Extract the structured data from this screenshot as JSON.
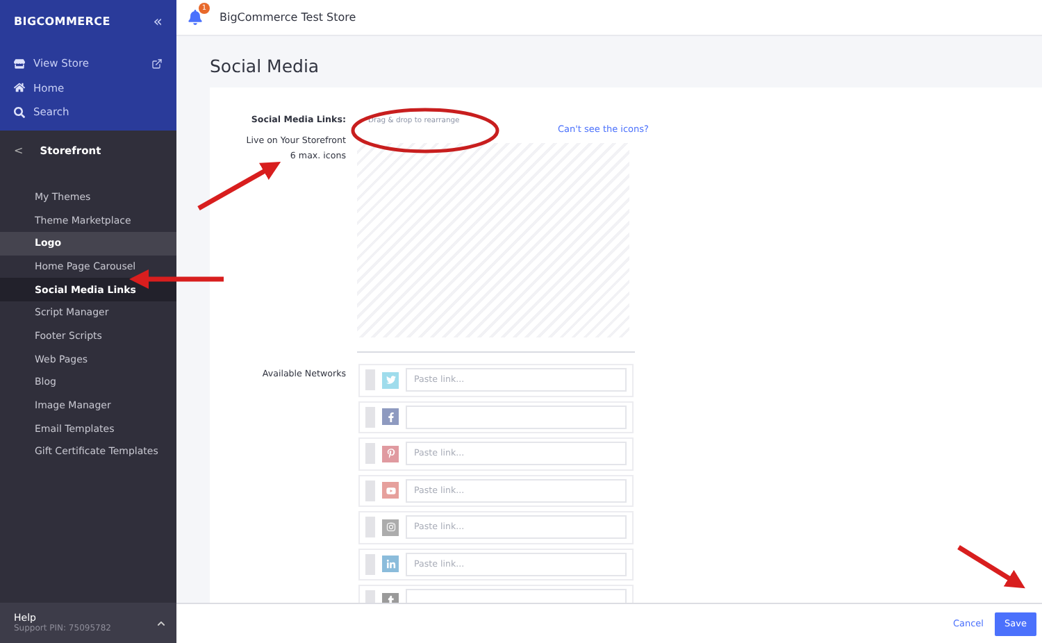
{
  "sidebar": {
    "logo": "BIGCOMMERCE",
    "collapse": "«",
    "nav": [
      {
        "label": "View Store",
        "kind": "store"
      },
      {
        "label": "Home",
        "kind": "home"
      },
      {
        "label": "Search",
        "kind": "search"
      }
    ],
    "section": {
      "back": "<",
      "title": "Storefront"
    },
    "items": [
      {
        "label": "My Themes",
        "selected": false,
        "hovered": false
      },
      {
        "label": "Theme Marketplace",
        "selected": false,
        "hovered": false
      },
      {
        "label": "Logo",
        "selected": false,
        "hovered": true
      },
      {
        "label": "Home Page Carousel",
        "selected": false,
        "hovered": false
      },
      {
        "label": "Social Media Links",
        "selected": true,
        "hovered": false
      },
      {
        "label": "Script Manager",
        "selected": false,
        "hovered": false
      },
      {
        "label": "Footer Scripts",
        "selected": false,
        "hovered": false
      },
      {
        "label": "Web Pages",
        "selected": false,
        "hovered": false
      },
      {
        "label": "Blog",
        "selected": false,
        "hovered": false
      },
      {
        "label": "Image Manager",
        "selected": false,
        "hovered": false
      },
      {
        "label": "Email Templates",
        "selected": false,
        "hovered": false
      },
      {
        "label": "Gift Certificate Templates",
        "selected": false,
        "hovered": false
      }
    ],
    "help": {
      "title": "Help",
      "pin": "Support PIN: 75095782"
    }
  },
  "header": {
    "badge": "1",
    "store": "BigCommerce Test Store"
  },
  "page": {
    "title": "Social Media",
    "links_label": "Social Media Links:",
    "live_label": "Live on Your Storefront",
    "max_label": "6 max. icons",
    "drop_hint": "Drag & drop to rearrange",
    "help_link": "Can't see the icons?",
    "networks_label": "Available Networks",
    "networks": [
      {
        "kind": "twitter",
        "color": "#9fdcec",
        "placeholder": "Paste link..."
      },
      {
        "kind": "facebook",
        "color": "#8e9ac0"
      },
      {
        "kind": "pinterest",
        "color": "#e09aa0",
        "placeholder": "Paste link..."
      },
      {
        "kind": "youtube",
        "color": "#e6a09c",
        "placeholder": "Paste link..."
      },
      {
        "kind": "instagram",
        "color": "#acacac",
        "placeholder": "Paste link..."
      },
      {
        "kind": "linkedin",
        "color": "#8bbcdb",
        "placeholder": "Paste link..."
      },
      {
        "kind": "tumblr",
        "color": "#9a9a9a"
      }
    ]
  },
  "footer": {
    "cancel": "Cancel",
    "save": "Save"
  }
}
